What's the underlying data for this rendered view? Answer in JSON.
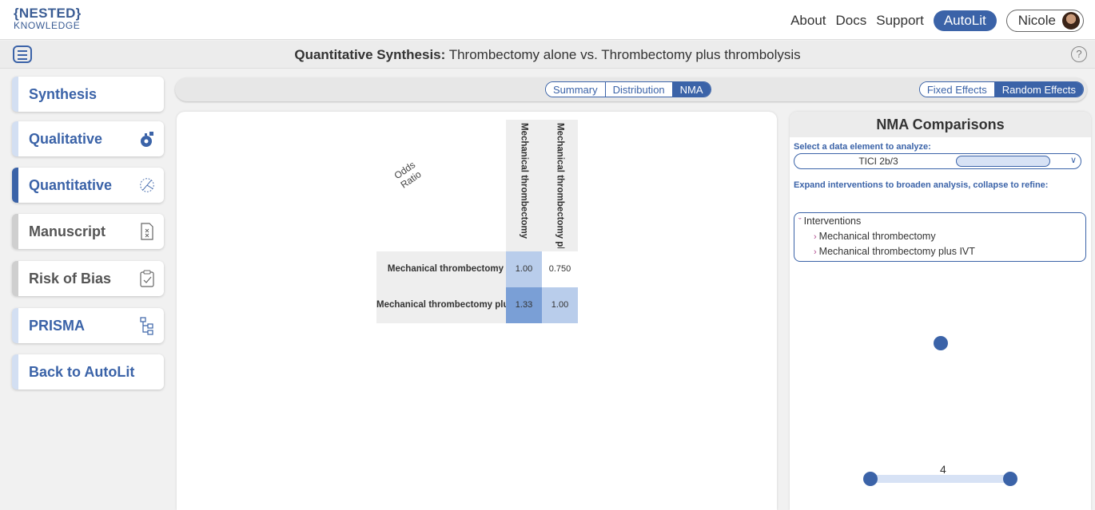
{
  "header": {
    "logo_line1": "{NESTED}",
    "logo_line2": "KNOWLEDGE",
    "nav": [
      "About",
      "Docs",
      "Support"
    ],
    "autolit_button": "AutoLit",
    "user_name": "Nicole"
  },
  "titlebar": {
    "title_bold": "Quantitative Synthesis:",
    "title_rest": " Thrombectomy alone vs. Thrombectomy plus thrombolysis",
    "help": "?"
  },
  "sidebar": {
    "items": [
      {
        "label": "Synthesis",
        "icon": "none"
      },
      {
        "label": "Qualitative",
        "icon": "gear-icon"
      },
      {
        "label": "Quantitative",
        "icon": "dial-icon"
      },
      {
        "label": "Manuscript",
        "icon": "document-icon"
      },
      {
        "label": "Risk of Bias",
        "icon": "clipboard-check-icon"
      },
      {
        "label": "PRISMA",
        "icon": "flowchart-icon"
      },
      {
        "label": "Back to AutoLit",
        "icon": "none"
      }
    ]
  },
  "toolbar": {
    "view_tabs": [
      "Summary",
      "Distribution",
      "NMA"
    ],
    "active_view": "NMA",
    "effect_tabs": [
      "Fixed Effects",
      "Random Effects"
    ],
    "active_effect": "Random Effects"
  },
  "matrix": {
    "metric_label": "Odds Ratio",
    "columns": [
      "Mechanical thrombectomy",
      "Mechanical thrombectomy pl..."
    ],
    "rows": [
      {
        "label": "Mechanical thrombectomy",
        "cells": [
          "1.00",
          "0.750"
        ]
      },
      {
        "label": "Mechanical thrombectomy plus",
        "cells": [
          "1.33",
          "1.00"
        ]
      }
    ]
  },
  "nma_panel": {
    "title": "NMA Comparisons",
    "select_label": "Select a data element to analyze:",
    "selected_element": "TICI 2b/3",
    "expand_label": "Expand interventions to broaden analysis, collapse to refine:",
    "tree_root": "Interventions",
    "tree_children": [
      "Mechanical thrombectomy",
      "Mechanical thrombectomy plus IVT"
    ],
    "network_edge_label": "4"
  },
  "colors": {
    "accent": "#3b63a8",
    "accent_light": "#d7e2f5",
    "cell_diag": "#b9cdeb",
    "cell_strong": "#7a9fd6",
    "tree_arrow": "#b04a8e"
  }
}
